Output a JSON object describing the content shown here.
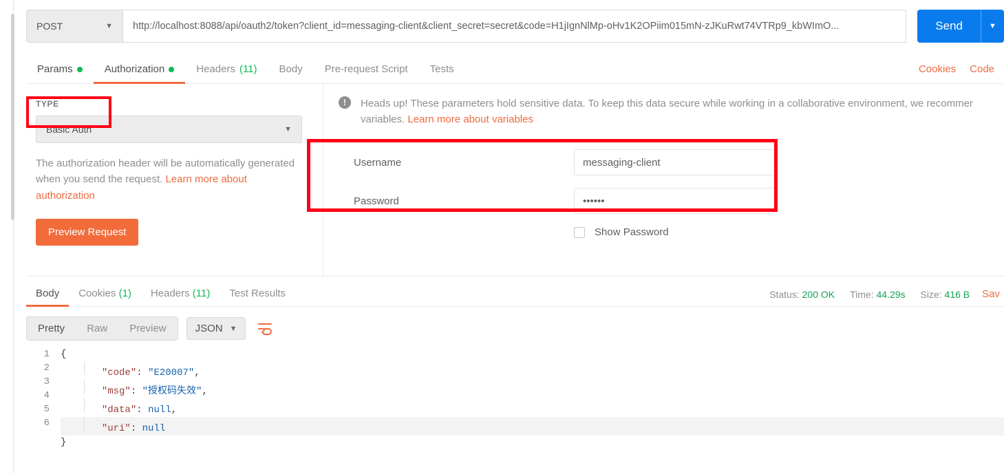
{
  "request": {
    "method": "POST",
    "url": "http://localhost:8088/api/oauth2/token?client_id=messaging-client&client_secret=secret&code=H1jIgnNlMp-oHv1K2OPiim015mN-zJKuRwt74VTRp9_kbWImO...",
    "send_label": "Send"
  },
  "tabs": {
    "params": "Params",
    "authorization": "Authorization",
    "headers": "Headers",
    "headers_count": "(11)",
    "body": "Body",
    "prerequest": "Pre-request Script",
    "tests": "Tests",
    "cookies_link": "Cookies",
    "code_link": "Code"
  },
  "auth": {
    "type_label": "TYPE",
    "type_value": "Basic Auth",
    "desc_prefix": "The authorization header will be automatically generated when you send the request. ",
    "desc_link": "Learn more about authorization",
    "preview_btn": "Preview Request",
    "heads_up_text": "Heads up! These parameters hold sensitive data. To keep this data secure while working in a collaborative environment, we recommer variables. ",
    "heads_up_link": "Learn more about variables",
    "username_label": "Username",
    "username_value": "messaging-client",
    "password_label": "Password",
    "password_value": "secret",
    "show_password": "Show Password"
  },
  "response": {
    "body_tab": "Body",
    "cookies_tab": "Cookies",
    "cookies_count": "(1)",
    "headers_tab": "Headers",
    "headers_count": "(11)",
    "tests_tab": "Test Results",
    "status_label": "Status:",
    "status_value": "200 OK",
    "time_label": "Time:",
    "time_value": "44.29s",
    "size_label": "Size:",
    "size_value": "416 B",
    "save": "Sav"
  },
  "body_toolbar": {
    "pretty": "Pretty",
    "raw": "Raw",
    "preview": "Preview",
    "lang": "JSON"
  },
  "json": {
    "l1": "{",
    "l2_k": "\"code\"",
    "l2_v": "\"E20007\"",
    "l3_k": "\"msg\"",
    "l3_v": "\"授权码失效\"",
    "l4_k": "\"data\"",
    "l4_v": "null",
    "l5_k": "\"uri\"",
    "l5_v": "null",
    "l6": "}"
  }
}
